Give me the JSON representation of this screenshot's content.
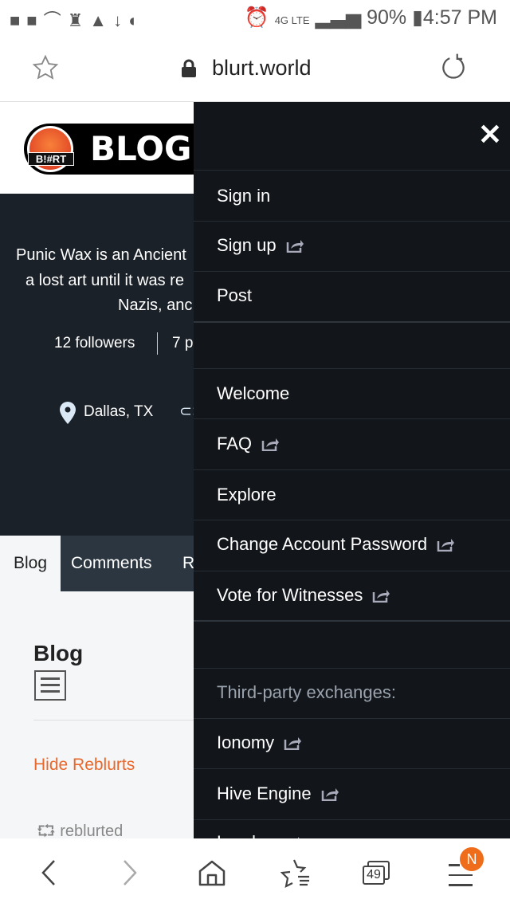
{
  "status_bar": {
    "left_icons": [
      "message-icon",
      "folder-icon",
      "missed-call-icon",
      "keyhole-icon",
      "warning-icon",
      "download-icon",
      "shield-icon"
    ],
    "battery": "90%",
    "time": "4:57 PM",
    "network": "4G LTE"
  },
  "browser": {
    "url": "blurt.world"
  },
  "profile": {
    "logo_text": "BLOG",
    "badge_text": "B!#RT",
    "bio_lines": [
      "Punic Wax is an Ancient",
      "a lost art until it was re",
      "Nazis, anc"
    ],
    "followers": "12 followers",
    "posts": "7 p",
    "location": "Dallas, TX"
  },
  "tabs": [
    "Blog",
    "Comments",
    "R"
  ],
  "content": {
    "heading": "Blog",
    "hide_reblurts": "Hide Reblurts",
    "reblurted": "reblurted"
  },
  "drawer": {
    "items": [
      {
        "label": "Sign in"
      },
      {
        "label": "Sign up",
        "ext": true
      },
      {
        "label": "Post"
      },
      {
        "label": "Welcome"
      },
      {
        "label": "FAQ",
        "ext": true
      },
      {
        "label": "Explore"
      },
      {
        "label": "Change Account Password",
        "ext": true
      },
      {
        "label": "Vote for Witnesses",
        "ext": true
      },
      {
        "label": "Third-party exchanges:"
      },
      {
        "label": "Ionomy",
        "ext": true
      },
      {
        "label": "Hive Engine",
        "ext": true
      },
      {
        "label": "Leodex",
        "ext": true
      }
    ]
  },
  "bottom_nav": {
    "tabs_count": "49",
    "badge": "N"
  },
  "colors": {
    "accent": "#e9672a",
    "drawer_bg": "#12161b",
    "hero_bg": "#1b2128"
  }
}
